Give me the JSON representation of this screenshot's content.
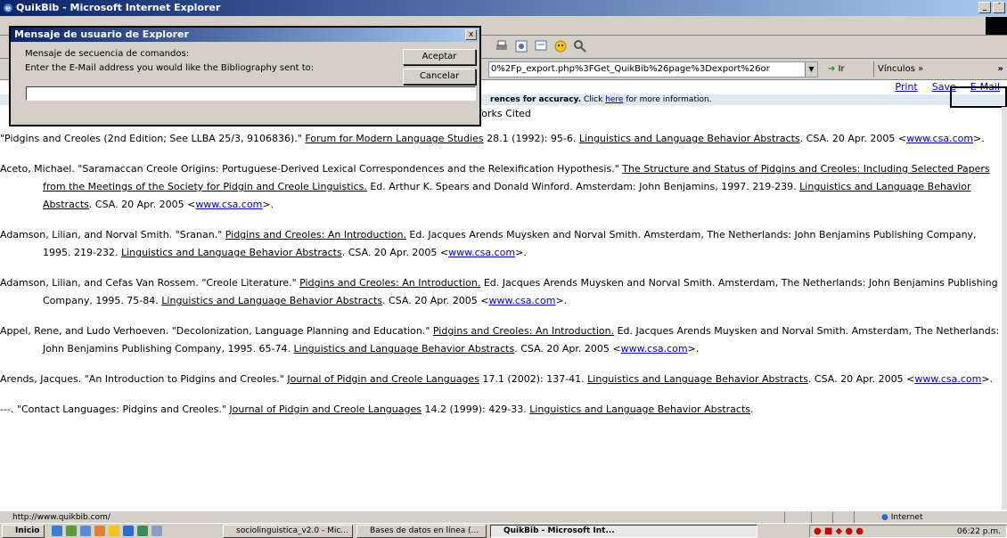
{
  "window": {
    "title": "QuikBib - Microsoft Internet Explorer",
    "min": "_",
    "max": "´",
    "close": "x"
  },
  "addressbar": {
    "url": "0%2Fp_export.php%3FGet_QuikBib%26page%3Dexport%26or",
    "go_label": "Ir",
    "links_label": "Vínculos »",
    "more": "»"
  },
  "page": {
    "actions": [
      "Print",
      "Save",
      "E-Mail"
    ],
    "notice_bold": "rences for accuracy.",
    "notice_rest": " Click ",
    "notice_link": "here",
    "notice_tail": " for more information.",
    "heading": "Works Cited"
  },
  "entries": [
    {
      "parts": [
        {
          "t": "\"Pidgins and Creoles (2nd Edition; See LLBA 25/3, 9106836).\" "
        },
        {
          "t": "Forum for Modern Language Studies",
          "u": true
        },
        {
          "t": " 28.1 (1992): 95-6. "
        },
        {
          "t": "Linguistics and Language Behavior Abstracts",
          "u": true
        },
        {
          "t": ". CSA. 20 Apr. 2005 <"
        },
        {
          "t": "www.csa.com",
          "link": true
        },
        {
          "t": ">."
        }
      ]
    },
    {
      "parts": [
        {
          "t": "Aceto, Michael. \"Saramaccan Creole Origins: Portuguese-Derived Lexical Correspondences and the Relexification Hypothesis.\" "
        },
        {
          "t": "The Structure and Status of Pidgins and Creoles: Including Selected Papers from the Meetings of the Society for Pidgin and Creole Linguistics.",
          "u": true
        },
        {
          "t": " Ed. Arthur K. Spears and Donald Winford. Amsterdam: John Benjamins, 1997. 219-239. "
        },
        {
          "t": "Linguistics and Language Behavior Abstracts",
          "u": true
        },
        {
          "t": ". CSA. 20 Apr. 2005 <"
        },
        {
          "t": "www.csa.com",
          "link": true
        },
        {
          "t": ">."
        }
      ]
    },
    {
      "parts": [
        {
          "t": "Adamson, Lilian, and Norval Smith. \"Sranan.\" "
        },
        {
          "t": "Pidgins and Creoles: An Introduction.",
          "u": true
        },
        {
          "t": " Ed. Jacques Arends Muysken and Norval Smith. Amsterdam, The Netherlands: John Benjamins Publishing Company, 1995. 219-232. "
        },
        {
          "t": "Linguistics and Language Behavior Abstracts",
          "u": true
        },
        {
          "t": ". CSA. 20 Apr. 2005 <"
        },
        {
          "t": "www.csa.com",
          "link": true
        },
        {
          "t": ">."
        }
      ]
    },
    {
      "parts": [
        {
          "t": "Adamson, Lilian, and Cefas Van Rossem. \"Creole Literature.\" "
        },
        {
          "t": "Pidgins and Creoles: An Introduction.",
          "u": true
        },
        {
          "t": " Ed. Jacques Arends Muysken and Norval Smith. Amsterdam, The Netherlands: John Benjamins Publishing Company, 1995. 75-84. "
        },
        {
          "t": "Linguistics and Language Behavior Abstracts",
          "u": true
        },
        {
          "t": ". CSA. 20 Apr. 2005 <"
        },
        {
          "t": "www.csa.com",
          "link": true
        },
        {
          "t": ">."
        }
      ]
    },
    {
      "parts": [
        {
          "t": "Appel, Rene, and Ludo Verhoeven. \"Decolonization, Language Planning and Education.\" "
        },
        {
          "t": "Pidgins and Creoles: An Introduction.",
          "u": true
        },
        {
          "t": " Ed. Jacques Arends Muysken and Norval Smith. Amsterdam, The Netherlands: John Benjamins Publishing Company, 1995. 65-74. "
        },
        {
          "t": "Linguistics and Language Behavior Abstracts",
          "u": true
        },
        {
          "t": ". CSA. 20 Apr. 2005 <"
        },
        {
          "t": "www.csa.com",
          "link": true
        },
        {
          "t": ">."
        }
      ]
    },
    {
      "parts": [
        {
          "t": "Arends, Jacques. \"An Introduction to Pidgins and Creoles.\" "
        },
        {
          "t": "Journal of Pidgin and Creole Languages",
          "u": true
        },
        {
          "t": " 17.1 (2002): 137-41. "
        },
        {
          "t": "Linguistics and Language Behavior Abstracts",
          "u": true
        },
        {
          "t": ". CSA. 20 Apr. 2005 <"
        },
        {
          "t": "www.csa.com",
          "link": true
        },
        {
          "t": ">."
        }
      ]
    },
    {
      "parts": [
        {
          "t": "---. \"Contact Languages: Pidgins and Creoles.\" "
        },
        {
          "t": "Journal of Pidgin and Creole Languages",
          "u": true
        },
        {
          "t": " 14.2 (1999): 429-33. "
        },
        {
          "t": "Linguistics and Language Behavior Abstracts",
          "u": true
        },
        {
          "t": "."
        }
      ]
    }
  ],
  "dialog": {
    "title": "Mensaje de usuario de Explorer",
    "line1": "Mensaje de secuencia de comandos:",
    "line2": "Enter the E-Mail address you would like the Bibliography sent to:",
    "ok": "Aceptar",
    "cancel": "Cancelar",
    "close": "x",
    "input_value": ""
  },
  "status": {
    "url": "http://www.quikbib.com/",
    "zone": "Internet"
  },
  "taskbar": {
    "start": "Inicio",
    "tasks": [
      {
        "label": "sociolinguistica_v2.0 - Mic...",
        "active": false
      },
      {
        "label": "Bases de datos en línea (...",
        "active": false
      },
      {
        "label": "QuikBib - Microsoft Int...",
        "active": true
      }
    ],
    "clock": "06:22 p.m."
  },
  "colors": {
    "title_gradient_start": "#0a246a",
    "link": "#0000cc",
    "chrome": "#d4d0c8"
  }
}
